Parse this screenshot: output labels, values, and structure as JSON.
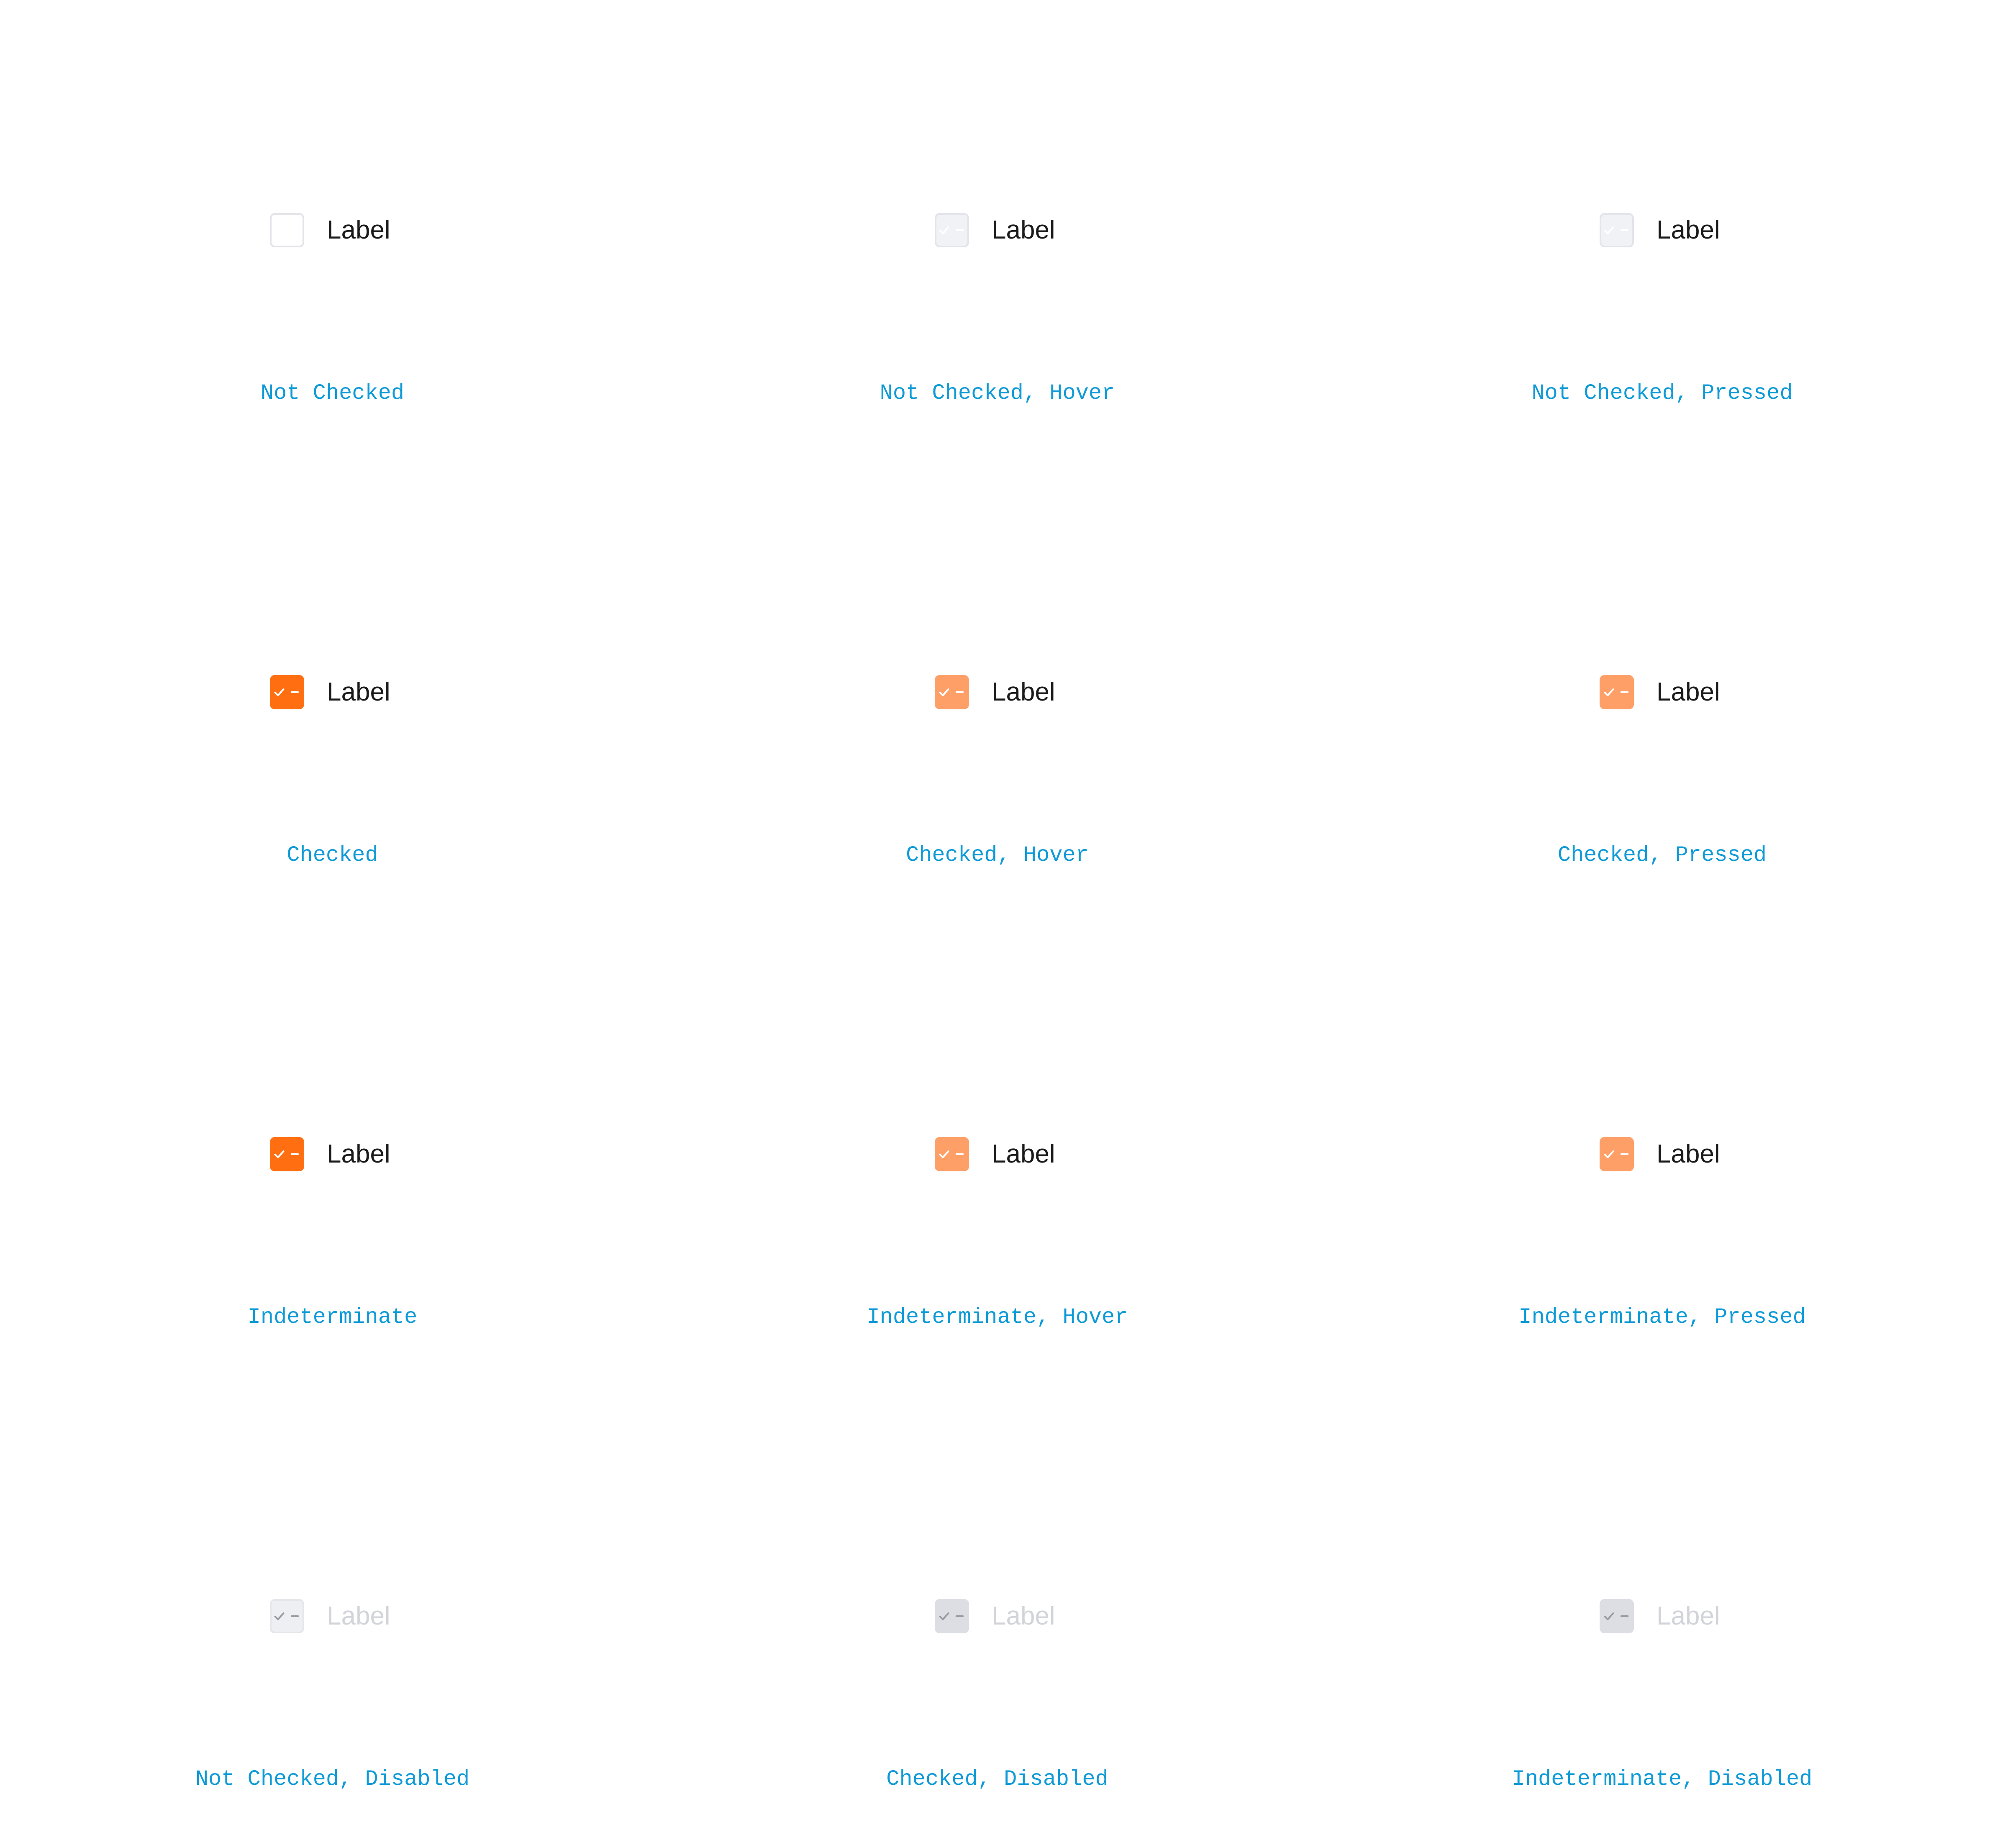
{
  "colors": {
    "accent": "#ff6f12",
    "accent_soft": "#ff9f68",
    "caption": "#0e9ad6",
    "border": "#e2e4e9",
    "hover_fill": "#f1f2f5",
    "disabled_fill": "#dcdee3",
    "disabled_text": "#d2d4da",
    "mark_white": "#ffffff",
    "mark_disabled": "#9a9ca4"
  },
  "rows": [
    [
      {
        "state": "unchecked",
        "label": "Label",
        "caption": "Not Checked"
      },
      {
        "state": "unchecked-hover",
        "label": "Label",
        "caption": "Not Checked, Hover"
      },
      {
        "state": "unchecked-pressed",
        "label": "Label",
        "caption": "Not Checked, Pressed"
      }
    ],
    [
      {
        "state": "checked",
        "label": "Label",
        "caption": "Checked",
        "icon": "checkmark-icon"
      },
      {
        "state": "checked-hover",
        "label": "Label",
        "caption": "Checked, Hover",
        "icon": "checkmark-icon"
      },
      {
        "state": "checked-pressed",
        "label": "Label",
        "caption": "Checked, Pressed",
        "icon": "checkmark-icon"
      }
    ],
    [
      {
        "state": "indeterminate",
        "label": "Label",
        "caption": "Indeterminate",
        "icon": "minus-icon"
      },
      {
        "state": "indeterminate-hover",
        "label": "Label",
        "caption": "Indeterminate, Hover",
        "icon": "minus-icon"
      },
      {
        "state": "indeterminate-pressed",
        "label": "Label",
        "caption": "Indeterminate, Pressed",
        "icon": "minus-icon"
      }
    ],
    [
      {
        "state": "unchecked-disabled",
        "label": "Label",
        "caption": "Not Checked, Disabled"
      },
      {
        "state": "checked-disabled",
        "label": "Label",
        "caption": "Checked, Disabled",
        "icon": "checkmark-icon"
      },
      {
        "state": "indeterminate-disabled",
        "label": "Label",
        "caption": "Indeterminate, Disabled",
        "icon": "minus-icon"
      }
    ]
  ]
}
